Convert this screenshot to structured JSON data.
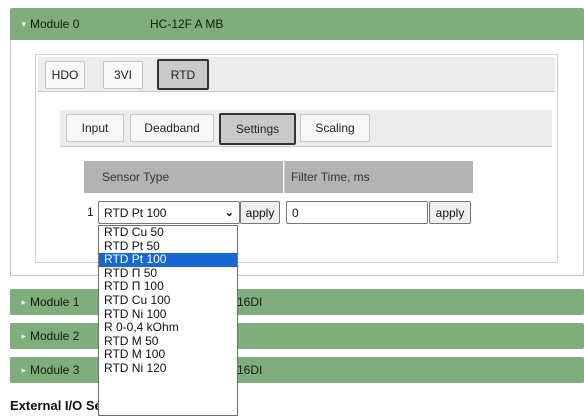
{
  "modules": [
    {
      "title": "Module 0",
      "type": "HC-12F A MB",
      "expanded": true
    },
    {
      "title": "Module 1",
      "type": "16DI",
      "expanded": false
    },
    {
      "title": "Module 2",
      "type": "",
      "expanded": false
    },
    {
      "title": "Module 3",
      "type": "16DI",
      "expanded": false
    }
  ],
  "module_tabs": [
    {
      "label": "HDO",
      "active": false
    },
    {
      "label": "3VI",
      "active": false
    },
    {
      "label": "RTD",
      "active": true
    }
  ],
  "rtd_tabs": [
    {
      "label": "Input",
      "active": false
    },
    {
      "label": "Deadband",
      "active": false
    },
    {
      "label": "Settings",
      "active": true
    },
    {
      "label": "Scaling",
      "active": false
    }
  ],
  "settings_table": {
    "headers": [
      "Sensor Type",
      "Filter Time, ms"
    ],
    "rows": [
      {
        "index": "1",
        "sensor_type": "RTD Pt 100",
        "filter_time": "0"
      }
    ],
    "apply_label": "apply"
  },
  "sensor_options": [
    "RTD Cu 50",
    "RTD Pt 50",
    "RTD Pt 100",
    "RTD П 50",
    "RTD П 100",
    "RTD Cu 100",
    "RTD Ni 100",
    "R 0-0,4 kOhm",
    "RTD M 50",
    "RTD M 100",
    "RTD Ni 120"
  ],
  "selected_option": "RTD Pt 100",
  "section_title": "External I/O Settings",
  "colors": {
    "module_bar": "#7fad7c",
    "selected_option": "#1967d2",
    "grid_header": "#b3b3b3"
  }
}
